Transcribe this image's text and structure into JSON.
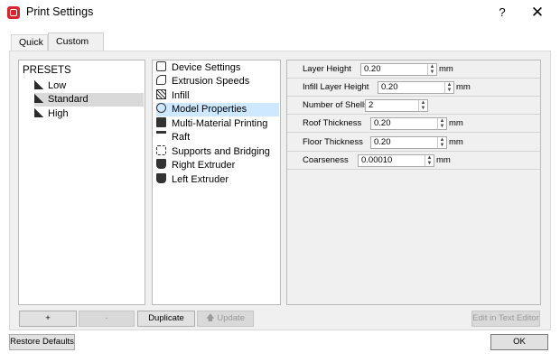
{
  "window": {
    "title": "Print Settings",
    "help_label": "?",
    "close_label": "✕"
  },
  "tabs": [
    {
      "label": "Quick"
    },
    {
      "label": "Custom"
    }
  ],
  "presets": {
    "header": "PRESETS",
    "items": [
      {
        "label": "Low",
        "selected": false
      },
      {
        "label": "Standard",
        "selected": true
      },
      {
        "label": "High",
        "selected": false
      }
    ]
  },
  "categories": [
    {
      "label": "Device Settings",
      "icon": "window-icon"
    },
    {
      "label": "Extrusion Speeds",
      "icon": "speed-icon"
    },
    {
      "label": "Infill",
      "icon": "infill-icon"
    },
    {
      "label": "Model Properties",
      "icon": "model-icon",
      "selected": true
    },
    {
      "label": "Multi-Material Printing",
      "icon": "multi-material-icon"
    },
    {
      "label": "Raft",
      "icon": "raft-icon"
    },
    {
      "label": "Supports and Bridging",
      "icon": "supports-icon"
    },
    {
      "label": "Right Extruder",
      "icon": "extruder-icon"
    },
    {
      "label": "Left Extruder",
      "icon": "extruder-icon"
    }
  ],
  "properties": [
    {
      "label": "Layer Height",
      "value": "0.20",
      "unit": "mm"
    },
    {
      "label": "Infill Layer Height",
      "value": "0.20",
      "unit": "mm"
    },
    {
      "label": "Number of Shells",
      "value": "2",
      "unit": ""
    },
    {
      "label": "Roof Thickness",
      "value": "0.20",
      "unit": "mm"
    },
    {
      "label": "Floor Thickness",
      "value": "0.20",
      "unit": "mm"
    },
    {
      "label": "Coarseness",
      "value": "0.00010",
      "unit": "mm"
    }
  ],
  "buttons": {
    "add": "+",
    "remove": "-",
    "duplicate": "Duplicate",
    "update": "Update",
    "edit_text_editor": "Edit in Text Editor",
    "restore_defaults": "Restore Defaults",
    "ok": "OK"
  },
  "colors": {
    "accent_red": "#d8262e",
    "selection_blue": "#cde8ff"
  }
}
